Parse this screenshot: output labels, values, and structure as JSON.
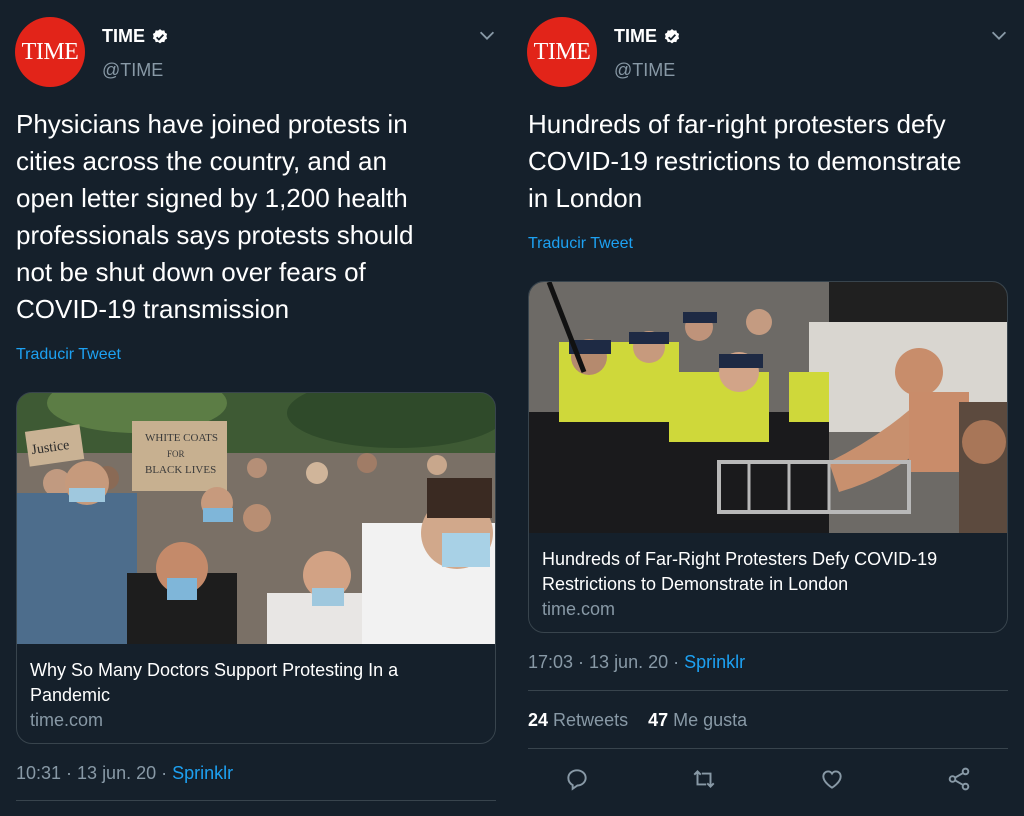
{
  "left_tweet": {
    "avatar_text": "TIME",
    "display_name": "TIME",
    "handle": "@TIME",
    "text": "Physicians have joined protests in\ncities across the country, and an\nopen letter signed by 1,200 health\nprofessionals says protests should\nnot be shut down over fears of\nCOVID-19 transmission",
    "translate": "Traducir Tweet",
    "card": {
      "title": "Why So Many Doctors Support Protesting In a\nPandemic",
      "domain": "time.com",
      "image_signs": [
        "Justice",
        "WHITE COATS\nFOR\nBLACK LIVES"
      ]
    },
    "time": "10:31 · 13 jun. 20 · ",
    "source": "Sprinklr"
  },
  "right_tweet": {
    "avatar_text": "TIME",
    "display_name": "TIME",
    "handle": "@TIME",
    "text": "Hundreds of far-right protesters defy\nCOVID-19 restrictions to demonstrate\nin London",
    "translate": "Traducir Tweet",
    "card": {
      "title": "Hundreds of Far-Right Protesters Defy COVID-19\nRestrictions to Demonstrate in London",
      "domain": "time.com"
    },
    "time": "17:03 · 13 jun. 20 · ",
    "source": "Sprinklr",
    "retweets_count": "24",
    "retweets_label": "Retweets",
    "likes_count": "47",
    "likes_label": "Me gusta"
  },
  "icons": [
    "verified-badge-icon",
    "chevron-down-icon",
    "reply-icon",
    "retweet-icon",
    "like-icon",
    "share-icon"
  ],
  "colors": {
    "background": "#15202b",
    "accent": "#1da1f2",
    "muted": "#8899a6",
    "border": "#38444d",
    "brand": "#e22419"
  }
}
